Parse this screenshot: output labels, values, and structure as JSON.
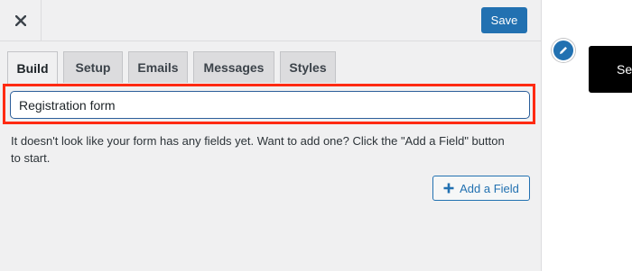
{
  "toolbar": {
    "close_icon": "close-icon",
    "save_label": "Save",
    "accent_color": "#2271b1"
  },
  "tabs": [
    {
      "label": "Build",
      "active": true
    },
    {
      "label": "Setup",
      "active": false
    },
    {
      "label": "Emails",
      "active": false
    },
    {
      "label": "Messages",
      "active": false
    },
    {
      "label": "Styles",
      "active": false
    }
  ],
  "form": {
    "name_value": "Registration form",
    "highlight_color": "#ff2a12"
  },
  "help_text": "It doesn't look like your form has any fields yet. Want to add one? Click the \"Add a Field\" button to start.",
  "add_field_label": "Add a Field",
  "side": {
    "edit_icon": "pencil-icon",
    "button_label": "Se"
  }
}
